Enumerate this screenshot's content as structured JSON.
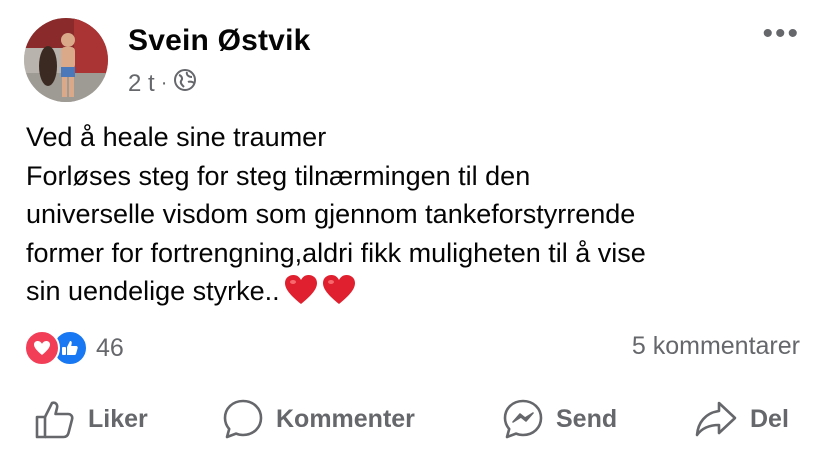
{
  "post": {
    "author": "Svein Østvik",
    "time": "2 t",
    "separator": "·",
    "privacy_icon": "globe-icon",
    "more_icon": "more-dots-icon",
    "more_label": "•••",
    "text_lines": [
      "Ved å heale sine traumer",
      "Forløses steg for steg tilnærmingen til den",
      "universelle visdom som gjennom tankeforstyrrende",
      "former for fortrengning,aldri fikk muligheten til å vise",
      "sin uendelige styrke.."
    ],
    "emoji": [
      "❤️",
      "❤️"
    ]
  },
  "stats": {
    "reaction_icons": [
      "love-reaction-icon",
      "like-reaction-icon"
    ],
    "reaction_count": "46",
    "comments": "5 kommentarer"
  },
  "actions": {
    "like": "Liker",
    "comment": "Kommenter",
    "send": "Send",
    "share": "Del"
  },
  "colors": {
    "text": "#050505",
    "secondary": "#65676b",
    "like_blue": "#1877f2",
    "love_red": "#f33e58",
    "heart_emoji": "#e0202e"
  }
}
